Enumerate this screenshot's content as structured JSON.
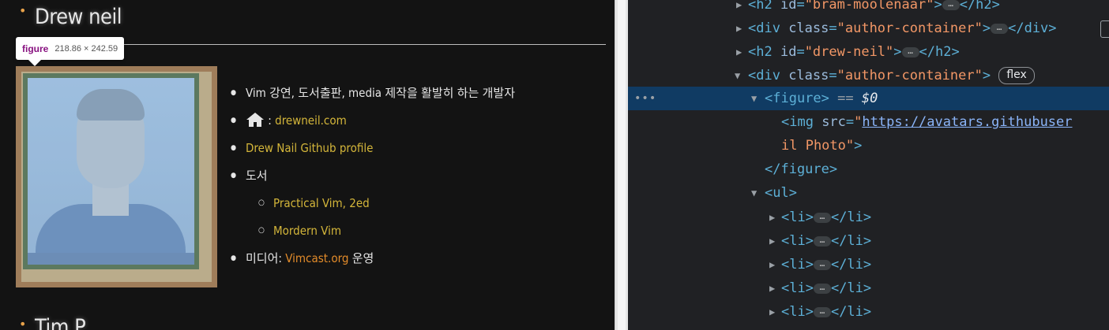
{
  "page": {
    "heading_drew": "Drew neil",
    "heading_next": "Tim P",
    "tooltip": {
      "tag": "figure",
      "size": "218.86 × 242.59"
    },
    "info": {
      "desc": "Vim 강연, 도서출판, media 제작을 활발히 하는 개발자",
      "home_sep": " : ",
      "home_link": "drewneil.com",
      "github_link": "Drew Nail Github profile",
      "books_label": "도서",
      "book1": "Practical Vim, 2ed",
      "book2": "Mordern Vim",
      "media_label": "미디어: ",
      "media_link": "Vimcast.org",
      "media_suffix": " 운영"
    }
  },
  "devtools": {
    "r0": {
      "tag_open": "<h2 ",
      "attr": "id",
      "val": "\"bram-moolenaar\"",
      "close": "</h2>"
    },
    "r1": {
      "tag_open": "<div ",
      "attr": "class",
      "val": "\"author-container\"",
      "close": "</div>"
    },
    "r2": {
      "tag_open": "<h2 ",
      "attr": "id",
      "val": "\"drew-neil\"",
      "close": "</h2>"
    },
    "r3": {
      "tag_open": "<div ",
      "attr": "class",
      "val": "\"author-container\"",
      "badge": "flex"
    },
    "r4": {
      "tag": "<figure>",
      "eq": " == ",
      "var": "$0"
    },
    "r5": {
      "tag_open": "<img ",
      "attr": "src",
      "link": "https://avatars.githubuser"
    },
    "r6": {
      "cont": "il Photo\"",
      "close": ">"
    },
    "r7": {
      "tag": "</figure>"
    },
    "r8": {
      "tag": "<ul>"
    },
    "li_open": "<li>",
    "li_close": "</li>",
    "ellipsis": "…",
    "dots": "•••",
    "eq_sign": "=",
    "quote": "\"",
    "gt": ">"
  }
}
